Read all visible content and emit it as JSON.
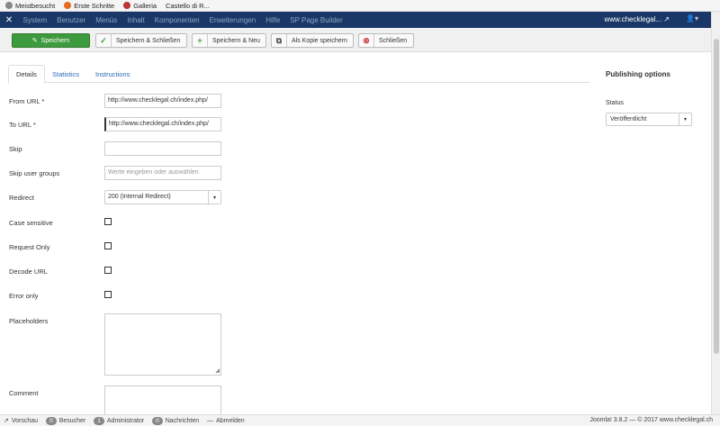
{
  "bookmarks": [
    "Meistbesucht",
    "Erste Schritte",
    "Galleria",
    "Castello di R..."
  ],
  "topnav": {
    "menu": [
      "System",
      "Benutzer",
      "Menüs",
      "Inhalt",
      "Komponenten",
      "Erweiterungen",
      "Hilfe",
      "SP Page Builder"
    ],
    "site": "www.checklegal...",
    "brand_color": "#1a3867"
  },
  "toolbar": {
    "save": "Speichern",
    "save_close": "Speichern & Schließen",
    "save_new": "Speichern & Neu",
    "save_copy": "Als Kopie speichern",
    "close": "Schließen"
  },
  "tabs": [
    "Details",
    "Statistics",
    "Instructions"
  ],
  "form": {
    "from_url_label": "From URL *",
    "from_url_value": "http://www.checklegal.ch/index.php/",
    "to_url_label": "To URL *",
    "to_url_value": "http://www.checklegal.ch/index.php/",
    "skip_label": "Skip",
    "skip_value": "",
    "skip_groups_label": "Skip user groups",
    "skip_groups_placeholder": "Werte eingeben oder auswählen",
    "redirect_label": "Redirect",
    "redirect_value": "200 (Internal Redirect)",
    "case_label": "Case sensitive",
    "request_label": "Request Only",
    "decode_label": "Decode URL",
    "error_label": "Error only",
    "placeholders_label": "Placeholders",
    "comment_label": "Comment"
  },
  "side": {
    "title": "Publishing options",
    "status_label": "Status",
    "status_value": "Veröffentlicht"
  },
  "status": {
    "preview": "Vorschau",
    "visitors_count": "0",
    "visitors": "Besucher",
    "admin_count": "1",
    "admin": "Administrator",
    "messages_count": "0",
    "messages": "Nachrichten",
    "logout": "Abmelden",
    "footer": "Joomla! 3.8.2 — © 2017 www.checklegal.ch"
  }
}
